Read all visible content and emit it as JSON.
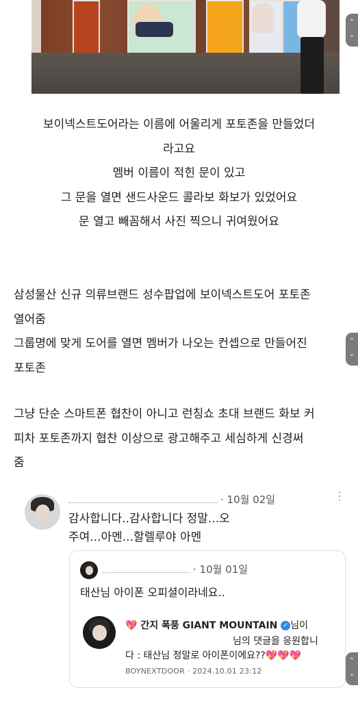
{
  "intro_lines": [
    "보이넥스트도어라는 이름에 어울리게 포토존을 만들었더",
    "라고요",
    "멤버 이름이 적힌 문이 있고",
    "그 문을 열면 샌드사운드 콜라보 화보가 있었어요",
    "문 열고 빼꼼해서 사진 찍으니 귀여웠어요"
  ],
  "block1_lines": [
    "삼성물산 신규 의류브랜드 성수팝업에 보이넥스트도어 포토존",
    "열어줌",
    "그룹명에 맞게 도어를 열면 멤버가 나오는 컨셉으로 만들어진",
    "포토존"
  ],
  "block2_lines": [
    "그냥 단순 스마트폰 협찬이 아니고 런칭쇼 초대 브랜드 화보 커",
    "피차 포토존까지 협찬 이상으로 광고해주고 세심하게 신경써",
    "줌"
  ],
  "comment": {
    "date": "· 10월 02일",
    "lines": [
      "감사합니다..감사합니다 정말...오",
      "주여...아멘...할렐루야 아멘"
    ],
    "more": "⋮"
  },
  "quote": {
    "date": "· 10월 01일",
    "text": "태산님 아이폰 오피셜이라네요..",
    "inner": {
      "heart1": "💖",
      "name": "간지 폭풍 GIANT MOUNTAIN",
      "verified": "✓",
      "name_tail": "님이",
      "line2": "님의 댓글을 응원합니",
      "line3": "다 : 태산님 정말로 아이폰이에요??",
      "hearts": "💖💖💖",
      "footer": "BOYNEXTDOOR · 2024.10.01 23:12"
    }
  },
  "scroll": {
    "up": "⌃",
    "down": "⌄"
  }
}
